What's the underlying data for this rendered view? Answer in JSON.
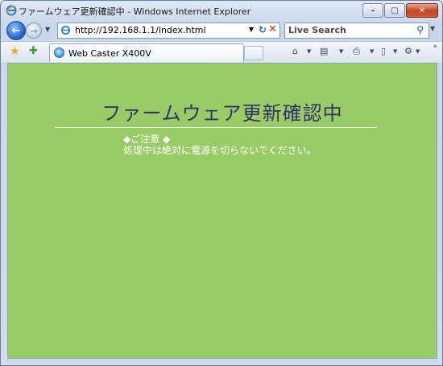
{
  "window": {
    "title": "ファームウェア更新確認中 - Windows Internet Explorer",
    "minimize": "–",
    "maximize": "□",
    "close": "✕"
  },
  "nav": {
    "back_icon": "←",
    "forward_icon": "→",
    "address": "http://192.168.1.1/index.html",
    "search_placeholder": "Live Search"
  },
  "tabs": [
    {
      "label": "Web Caster X400V"
    }
  ],
  "page": {
    "title": "ファームウェア更新確認中",
    "notice_heading": "◆ご注意 ◆",
    "notice_text": "処理中は絶対に電源を切らないでください。"
  },
  "colors": {
    "page_background": "#99cc66",
    "title_color": "#333366",
    "notice_color": "#ffffff"
  }
}
